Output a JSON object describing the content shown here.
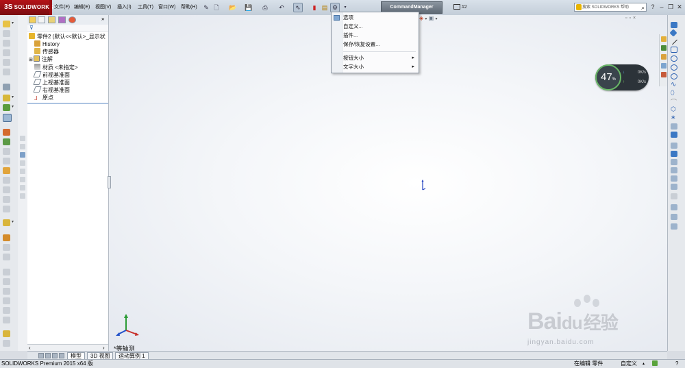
{
  "app": {
    "logo_text": "SOLIDWORKS",
    "logo_mark": "3S",
    "document_suffix": "#2"
  },
  "menu": [
    "文件(F)",
    "编辑(E)",
    "视图(V)",
    "插入(I)",
    "工具(T)",
    "窗口(W)",
    "帮助(H)"
  ],
  "command_manager": "CommandManager",
  "search": {
    "placeholder": "搜索 SOLIDWORKS 帮助"
  },
  "dropdown": {
    "items": [
      "选项",
      "自定义...",
      "插件...",
      "保存/恢复设置..."
    ],
    "submenus": [
      "按钮大小",
      "文字大小"
    ]
  },
  "feature_tree": {
    "root": "零件2 (默认<<默认>_显示状",
    "items": [
      "History",
      "传感器",
      "注解",
      "材质 <未指定>",
      "前视基准面",
      "上视基准面",
      "右视基准面",
      "原点"
    ]
  },
  "performance": {
    "percent": "47",
    "percent_unit": "%",
    "down": "0",
    "up": "0",
    "unit": "K/s"
  },
  "viewport": {
    "view_label": "*等轴测"
  },
  "bottom_tabs": [
    "模型",
    "3D 视图",
    "运动算例 1"
  ],
  "status": {
    "product": "SOLIDWORKS Premium 2015 x64 版",
    "editing": "在编辑 零件",
    "custom": "自定义"
  },
  "watermark": {
    "brand": "Bai",
    "brand_cn": "经验",
    "url": "jingyan.baidu.com"
  },
  "colors": {
    "logo_red": "#b31217",
    "perf_ring": "#69b867",
    "tree_line": "#4e7fc0"
  }
}
